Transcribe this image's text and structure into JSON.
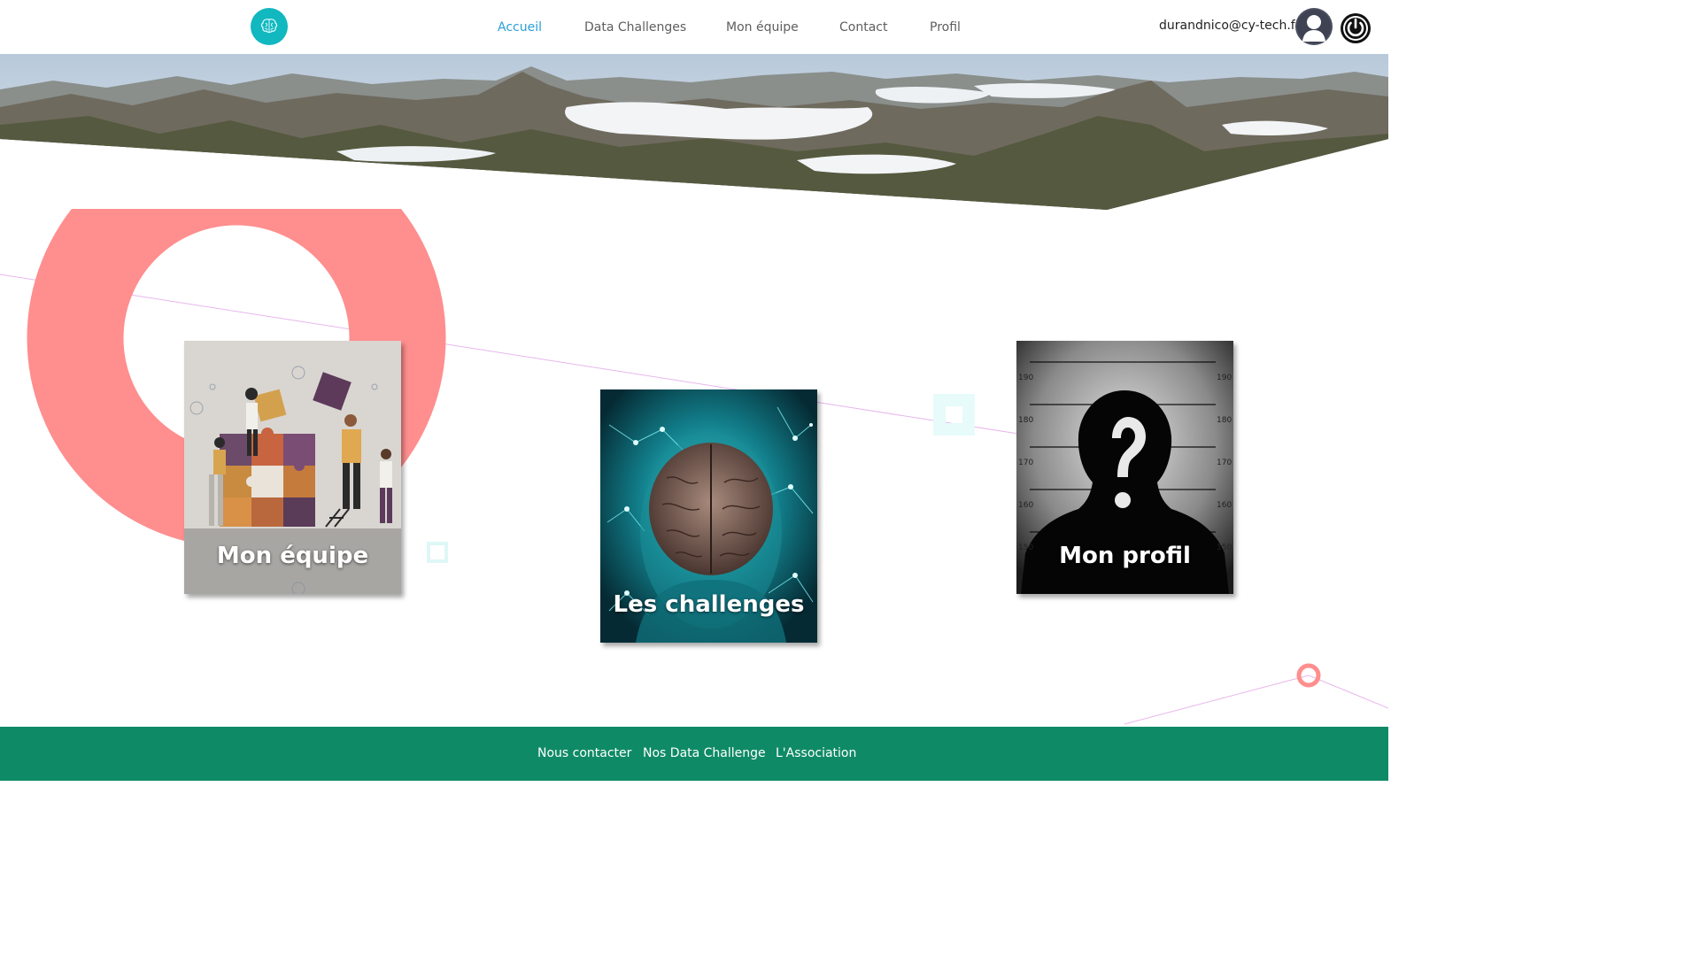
{
  "header": {
    "logo_icon": "brain-icon",
    "nav": [
      {
        "label": "Accueil",
        "active": true
      },
      {
        "label": "Data Challenges",
        "active": false
      },
      {
        "label": "Mon équipe",
        "active": false
      },
      {
        "label": "Contact",
        "active": false
      },
      {
        "label": "Profil",
        "active": false
      }
    ],
    "user_email": "durandnico@cy-tech.fr",
    "avatar_icon": "user-avatar-icon",
    "logout_icon": "power-icon"
  },
  "cards": [
    {
      "title": "Mon équipe",
      "image": "puzzle-team-illustration"
    },
    {
      "title": "Les challenges",
      "image": "digital-brain-illustration"
    },
    {
      "title": "Mon profil",
      "image": "mugshot-silhouette-illustration"
    }
  ],
  "mugshot_scale": [
    "190",
    "180",
    "170",
    "160",
    "150"
  ],
  "footer": {
    "links": [
      "Nous contacter",
      "Nos Data Challenge",
      "L'Association"
    ]
  },
  "colors": {
    "nav_active": "#2a9fd8",
    "logo_teal": "#11b8c0",
    "footer_green": "#0f8a66",
    "accent_coral": "#ff8e8e"
  }
}
